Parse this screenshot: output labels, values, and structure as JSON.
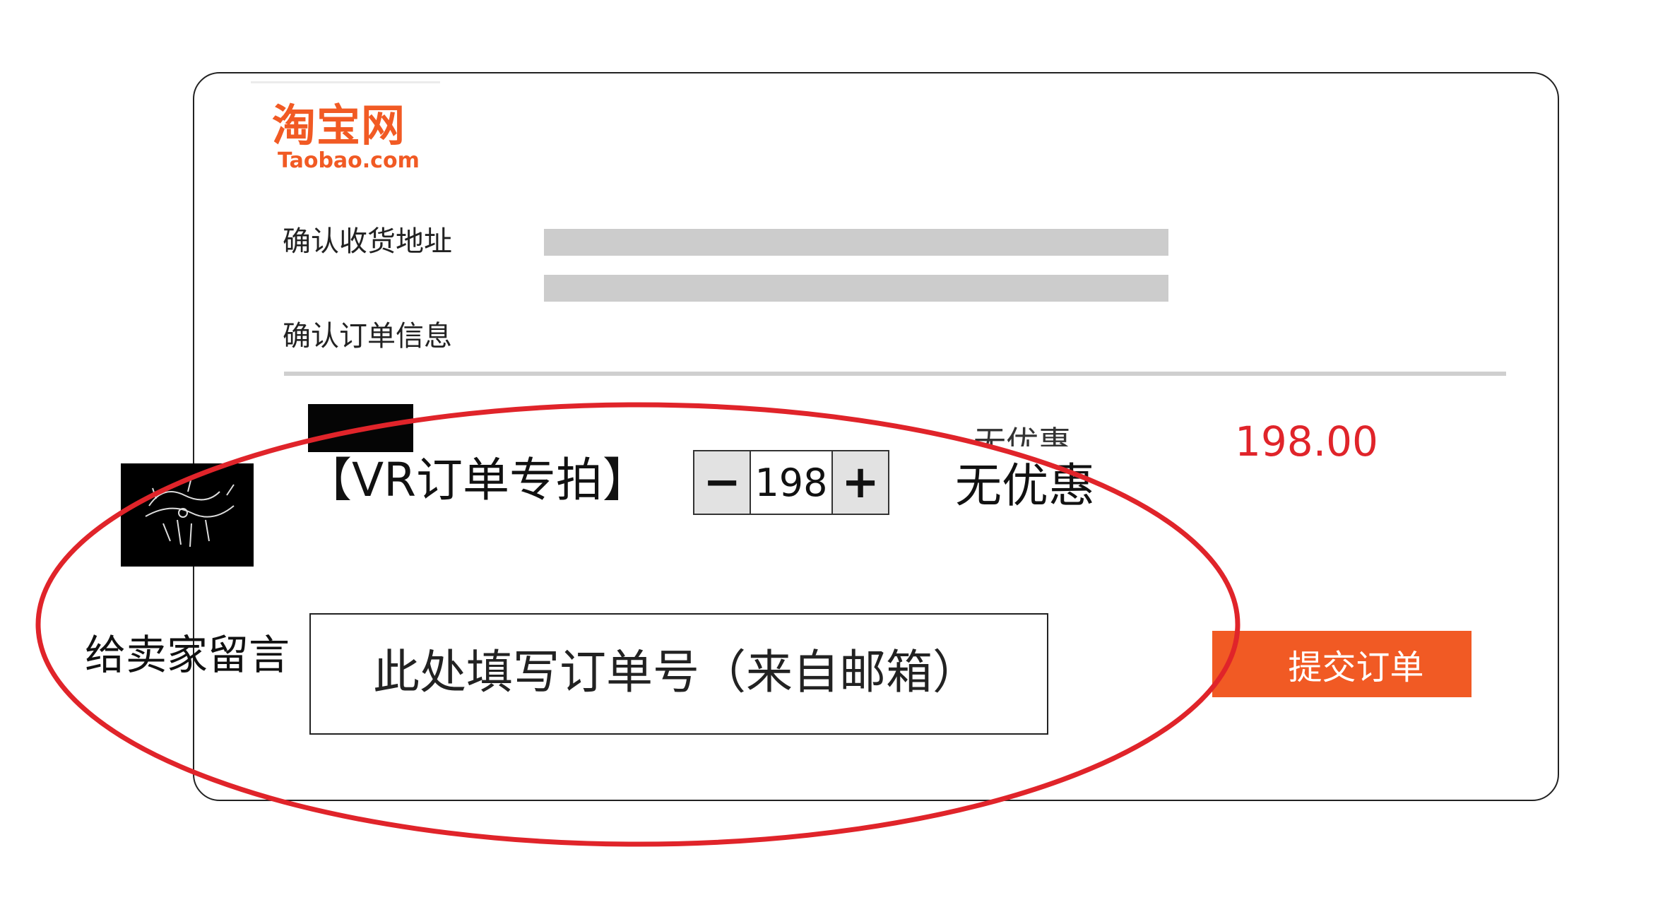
{
  "logo": {
    "name_cn": "淘宝网",
    "name_en": "Taobao.com",
    "brand_color": "#f15a24"
  },
  "address": {
    "label": "确认收货地址"
  },
  "order": {
    "label": "确认订单信息",
    "old_discount_text": "无优惠",
    "price": "198.00",
    "item_name": "【VR订单专拍】",
    "quantity": "198",
    "minus_label": "−",
    "plus_label": "+",
    "discount": "无优惠"
  },
  "message": {
    "label": "给卖家留言",
    "placeholder": "此处填写订单号（来自邮箱）"
  },
  "submit": {
    "label": "提交订单"
  },
  "colors": {
    "accent": "#f15a24",
    "price": "#e0242a",
    "highlight_ring": "#e0242a",
    "placeholder_bar": "#cccccc"
  }
}
